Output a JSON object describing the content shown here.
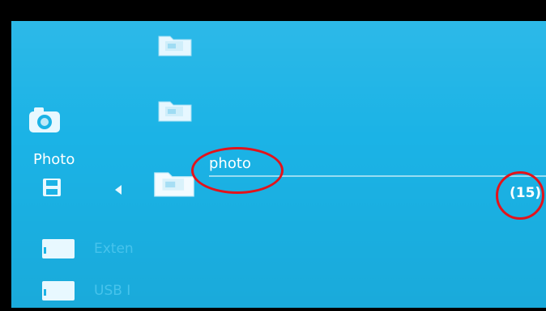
{
  "sidebar": {
    "current_label": "Photo",
    "icons": [
      "camera-icon",
      "save-icon",
      "back-arrow-icon"
    ],
    "storage": [
      {
        "label": "Exten",
        "icon": "card-icon"
      },
      {
        "label": "USB I",
        "icon": "usb-drive-icon"
      }
    ]
  },
  "folders": {
    "selected": {
      "name": "photo",
      "count": "(15)"
    }
  },
  "colors": {
    "background": "#1bb3e6",
    "annotation": "#e3131b",
    "text": "#ffffff"
  }
}
